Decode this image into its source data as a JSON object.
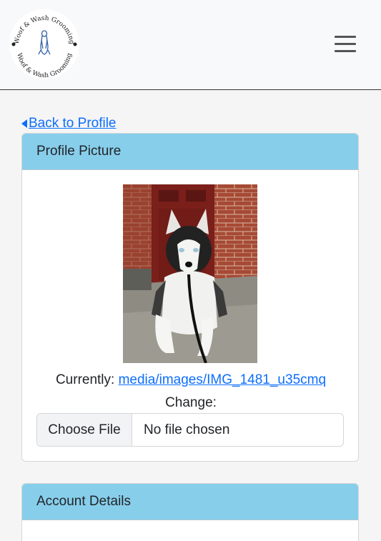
{
  "navbar": {
    "logo_text_top": "Woof & Wash Grooming",
    "logo_text_bottom": "Woof & Wash Grooming"
  },
  "back_link": {
    "label": "Back to Profile"
  },
  "profile_card": {
    "header": "Profile Picture",
    "currently_label": "Currently:",
    "current_file": "media/images/IMG_1481_u35cmq",
    "change_label": "Change:",
    "file_button": "Choose File",
    "file_status": "No file chosen"
  },
  "account_card": {
    "header": "Account Details"
  },
  "colors": {
    "card_header": "#87ceeb",
    "link": "#0d6efd",
    "navbar": "#f8f9fa"
  }
}
